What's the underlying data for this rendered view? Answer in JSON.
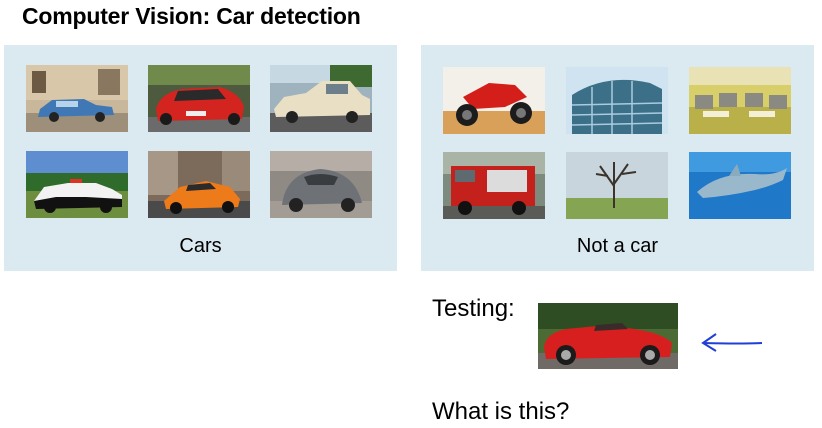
{
  "title": "Computer Vision: Car detection",
  "cars_panel": {
    "caption": "Cars",
    "images": [
      "vintage-blue-car",
      "red-sports-car",
      "cream-vintage-car",
      "police-car",
      "orange-lamborghini",
      "grey-beetle"
    ]
  },
  "notcar_panel": {
    "caption": "Not a car",
    "images": [
      "red-motorcycle",
      "glass-building",
      "office-cubicles",
      "fire-truck",
      "tree-field",
      "dolphin"
    ]
  },
  "testing_label": "Testing:",
  "test_image": "red-convertible-car",
  "question": "What is this?",
  "colors": {
    "panel": "#dbeaf1",
    "arrow": "#1f3fd6"
  }
}
